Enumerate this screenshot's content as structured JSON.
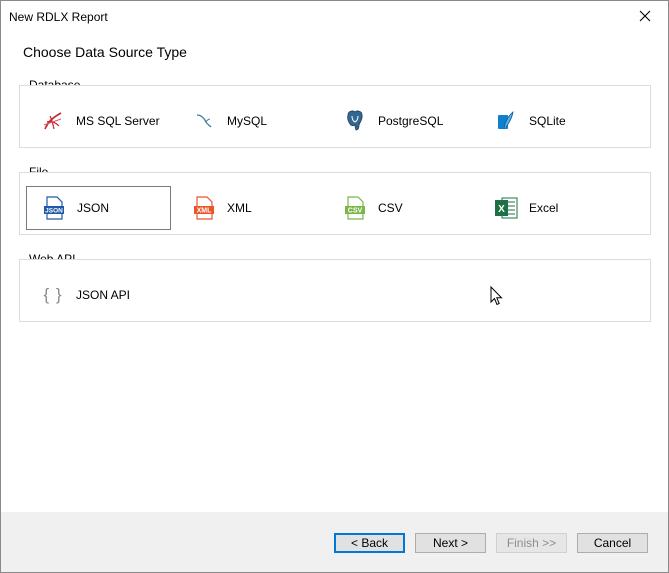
{
  "window": {
    "title": "New RDLX Report",
    "close_icon": "close-icon"
  },
  "heading": "Choose Data Source Type",
  "groups": {
    "database": {
      "label": "Database",
      "items": [
        {
          "label": "MS SQL Server",
          "icon": "sql-server-icon"
        },
        {
          "label": "MySQL",
          "icon": "mysql-icon"
        },
        {
          "label": "PostgreSQL",
          "icon": "postgresql-icon"
        },
        {
          "label": "SQLite",
          "icon": "sqlite-icon"
        }
      ]
    },
    "file": {
      "label": "File",
      "items": [
        {
          "label": "JSON",
          "icon": "json-file-icon",
          "icon_text": "JSON",
          "selected": true
        },
        {
          "label": "XML",
          "icon": "xml-file-icon",
          "icon_text": "XML"
        },
        {
          "label": "CSV",
          "icon": "csv-file-icon",
          "icon_text": "CSV"
        },
        {
          "label": "Excel",
          "icon": "excel-icon",
          "icon_text": "X"
        }
      ]
    },
    "webapi": {
      "label": "Web API",
      "items": [
        {
          "label": "JSON API",
          "icon": "curly-braces-icon",
          "icon_text": "{ }"
        }
      ]
    }
  },
  "buttons": {
    "back": "< Back",
    "next": "Next >",
    "finish": "Finish >>",
    "cancel": "Cancel"
  },
  "colors": {
    "selection_border": "#7a7a7a",
    "default_button_border": "#0078d7",
    "json_blue": "#1e5aa8",
    "xml_orange": "#e8562a",
    "csv_green": "#7ab648",
    "excel_green": "#1d7044"
  }
}
